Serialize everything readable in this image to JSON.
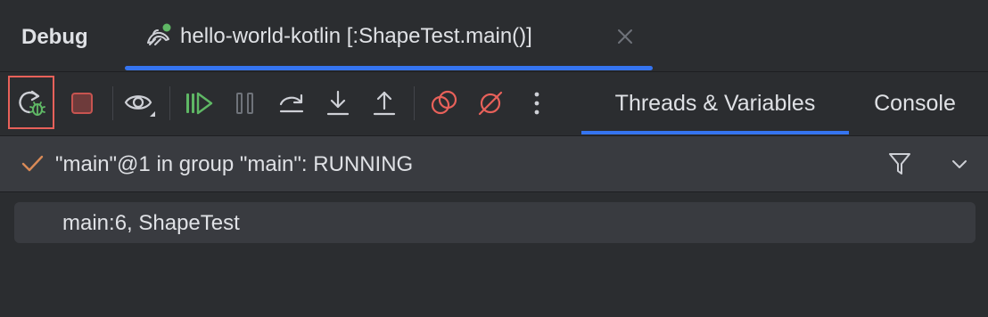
{
  "header": {
    "title": "Debug",
    "session_tab": {
      "label": "hello-world-kotlin [:ShapeTest.main()]",
      "icon": "kotlin-run-config-icon",
      "running_indicator_color": "#5fb865"
    }
  },
  "toolbar": {
    "buttons": [
      {
        "name": "rerun-debug",
        "icon": "rerun-bug-icon",
        "highlighted": true,
        "highlight_color": "#e8615a"
      },
      {
        "name": "stop",
        "icon": "stop-icon",
        "color": "#c75450"
      },
      {
        "name": "view-options",
        "icon": "eye-icon"
      },
      {
        "name": "resume",
        "icon": "resume-icon",
        "color": "#5fb865"
      },
      {
        "name": "pause",
        "icon": "pause-icon",
        "disabled": true
      },
      {
        "name": "step-over",
        "icon": "step-over-icon"
      },
      {
        "name": "step-into",
        "icon": "step-into-icon"
      },
      {
        "name": "step-out",
        "icon": "step-out-icon"
      },
      {
        "name": "view-breakpoints",
        "icon": "breakpoints-icon",
        "color": "#e8615a"
      },
      {
        "name": "mute-breakpoints",
        "icon": "mute-breakpoints-icon",
        "color": "#e8615a"
      },
      {
        "name": "more",
        "icon": "more-vertical-icon"
      }
    ],
    "tabs": [
      {
        "label": "Threads & Variables",
        "selected": true
      },
      {
        "label": "Console",
        "selected": false
      }
    ],
    "accent_color": "#3574f0"
  },
  "thread": {
    "label": "\"main\"@1 in group \"main\": RUNNING",
    "status_icon": "check-icon",
    "status_color": "#d98a57"
  },
  "frames": [
    {
      "label": "main:6, ShapeTest"
    }
  ]
}
